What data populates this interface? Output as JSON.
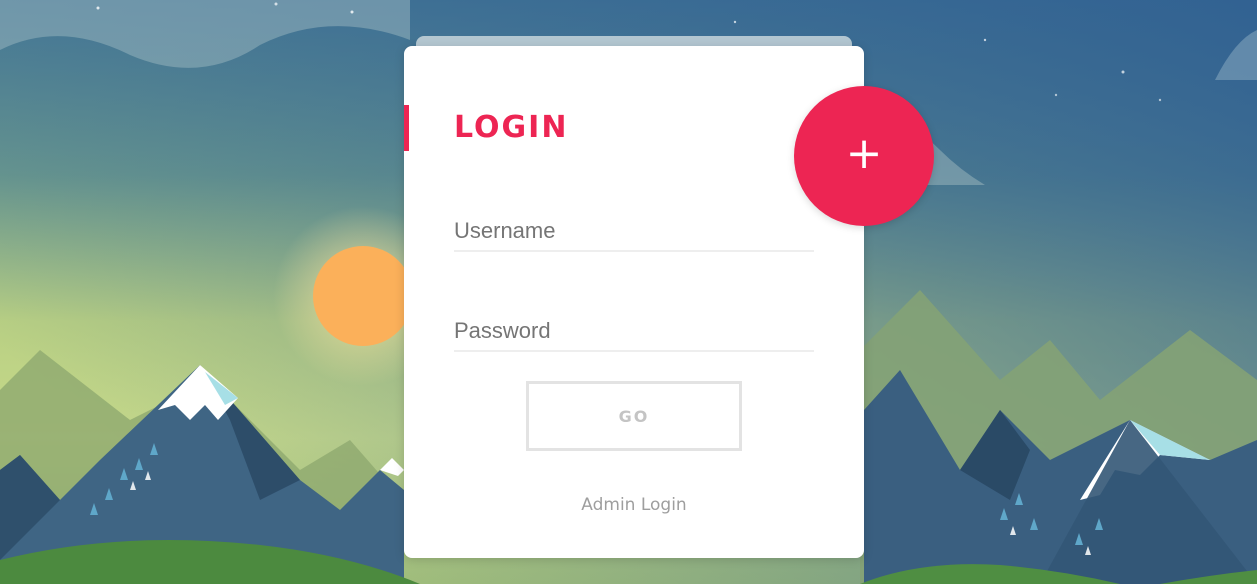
{
  "login_card": {
    "title": "LOGIN",
    "username_placeholder": "Username",
    "password_placeholder": "Password",
    "submit_label": "GO",
    "admin_link": "Admin Login"
  },
  "fab": {
    "icon": "plus-icon",
    "glyph": "+"
  },
  "colors": {
    "accent": "#ed2553",
    "card": "#ffffff",
    "sky_top": "#3e6b8f",
    "sky_glow": "#c6d98a"
  }
}
